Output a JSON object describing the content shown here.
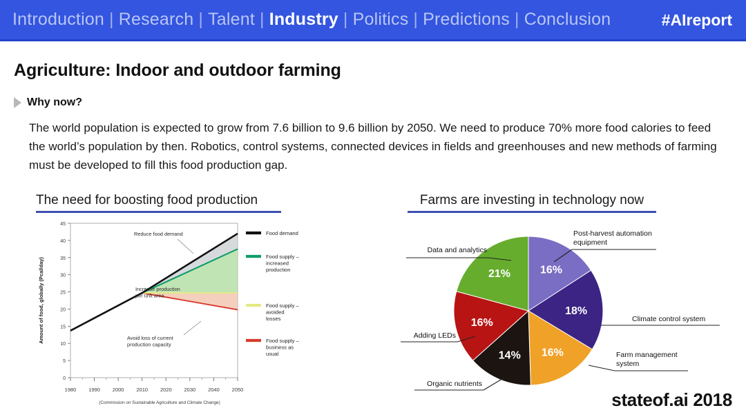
{
  "nav": {
    "items": [
      {
        "label": "Introduction",
        "active": false
      },
      {
        "label": "Research",
        "active": false
      },
      {
        "label": "Talent",
        "active": false
      },
      {
        "label": "Industry",
        "active": true
      },
      {
        "label": "Politics",
        "active": false
      },
      {
        "label": "Predictions",
        "active": false
      },
      {
        "label": "Conclusion",
        "active": false
      }
    ],
    "separator": "|",
    "brand": "#AIreport",
    "bg_color": "#3355e0",
    "inactive_color": "#b9c6f4",
    "active_color": "#ffffff"
  },
  "slide": {
    "title": "Agriculture: Indoor and outdoor farming",
    "why_label": "Why now?",
    "body": "The world population is expected to grow from 7.6 billion to 9.6 billion by 2050. We need to produce 70% more food calories to feed the world’s population by then. Robotics, control systems, connected devices in fields and greenhouses and new methods of farming must be developed to fill this food production gap.",
    "footer_brand": "stateof.ai 2018",
    "accent_color": "#3d4fb0"
  },
  "sections": {
    "left_heading": "The need for boosting food production",
    "right_heading": "Farms are investing in technology now"
  },
  "chart_data": [
    {
      "type": "area",
      "title": "The need for boosting food production",
      "xlabel": "",
      "ylabel": "Amount of food, globally (Pcal/day)",
      "caption": "(Commission on Sustainable Agriculture and Climate Change)",
      "xlim": [
        1980,
        2050
      ],
      "ylim": [
        0,
        45
      ],
      "xticks": [
        1980,
        1990,
        2000,
        2010,
        2020,
        2030,
        2040,
        2050
      ],
      "yticks": [
        0,
        5,
        10,
        15,
        20,
        25,
        30,
        35,
        40,
        45
      ],
      "grid": false,
      "legend_position": "right",
      "x": [
        1980,
        2010,
        2050
      ],
      "series": [
        {
          "name": "Food demand",
          "color": "#111111",
          "values": [
            13.7,
            24.7,
            42.0
          ]
        },
        {
          "name": "Food supply – increased production",
          "color": "#0f9d68",
          "values": [
            13.7,
            24.7,
            37.5
          ]
        },
        {
          "name": "Food supply – avoided losses",
          "color": "#e4ea83",
          "values": [
            13.7,
            24.7,
            24.7
          ]
        },
        {
          "name": "Food supply – business as usual",
          "color": "#d83b2e",
          "values": [
            13.7,
            24.7,
            19.8
          ]
        }
      ],
      "annotations": [
        "Reduce food demand",
        "Increase production per unit area",
        "Avoid loss of current production capacity"
      ]
    },
    {
      "type": "pie",
      "title": "Farms are investing in technology now",
      "legend_position": "callouts",
      "categories": [
        "Post-harvest automation equipment",
        "Climate control system",
        "Farm management system",
        "Organic nutrients",
        "Adding LEDs",
        "Data and analytics"
      ],
      "values": [
        16,
        18,
        16,
        14,
        16,
        21
      ],
      "value_labels": [
        "16%",
        "18%",
        "16%",
        "14%",
        "16%",
        "21%"
      ],
      "colors": [
        "#7a6dc4",
        "#3b2483",
        "#f0a128",
        "#1c1411",
        "#b81414",
        "#66ad2e"
      ]
    }
  ]
}
